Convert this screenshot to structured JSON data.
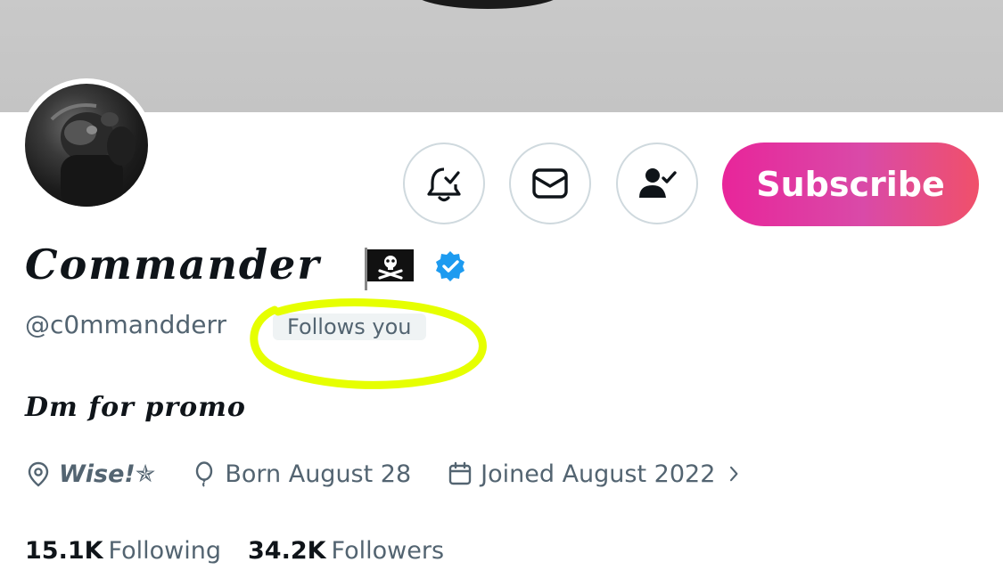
{
  "profile": {
    "display_name": "Commander",
    "handle": "@c0mmandderr",
    "follows_you": "Follows you",
    "bio": "Dm for promo",
    "location": "Wise!",
    "location_star": "✯",
    "birthday": "Born August 28",
    "joined": "Joined August 2022"
  },
  "actions": {
    "subscribe_label": "Subscribe",
    "icons": [
      "bell-check-icon",
      "mail-icon",
      "person-check-icon"
    ]
  },
  "stats": {
    "following_count": "15.1K",
    "following_label": "Following",
    "followers_count": "34.2K",
    "followers_label": "Followers"
  },
  "colors": {
    "subscribe_gradient_start": "#e8259a",
    "subscribe_gradient_end": "#f0506a",
    "verified_blue": "#1d9bf0",
    "annotation_highlight": "#e6ff00",
    "secondary_text": "#536471"
  }
}
